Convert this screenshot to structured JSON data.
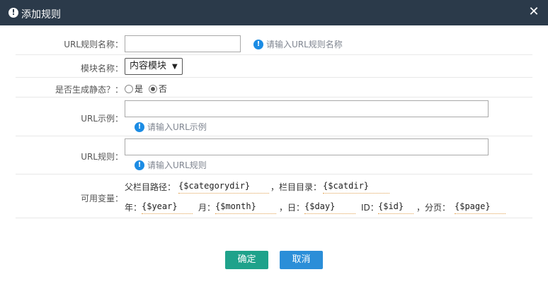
{
  "title": "添加规则",
  "form": {
    "rule_name_label": "URL规则名称：",
    "rule_name_value": "",
    "rule_name_hint": "请输入URL规则名称",
    "module_label": "模块名称：",
    "module_selected": "内容模块",
    "static_label": "是否生成静态？：",
    "static_options": [
      "是",
      "否"
    ],
    "static_selected": "否",
    "example_label": "URL示例：",
    "example_value": "",
    "example_hint": "请输入URL示例",
    "rule_label": "URL规则：",
    "rule_value": "",
    "rule_hint": "请输入URL规则",
    "vars_label": "可用变量："
  },
  "variables": {
    "parent_path_label": "父栏目路径：",
    "parent_path_value": "{$categorydir}",
    "cat_dir_label": "，栏目目录：",
    "cat_dir_value": "{$catdir}",
    "year_label": "年：",
    "year_value": "{$year}",
    "month_label": "月：",
    "month_value": "{$month}",
    "day_label": "，日：",
    "day_value": "{$day}",
    "id_label": "ID：",
    "id_value": "{$id}",
    "page_label": "，分页：",
    "page_value": "{$page}"
  },
  "buttons": {
    "ok": "确定",
    "cancel": "取消"
  }
}
